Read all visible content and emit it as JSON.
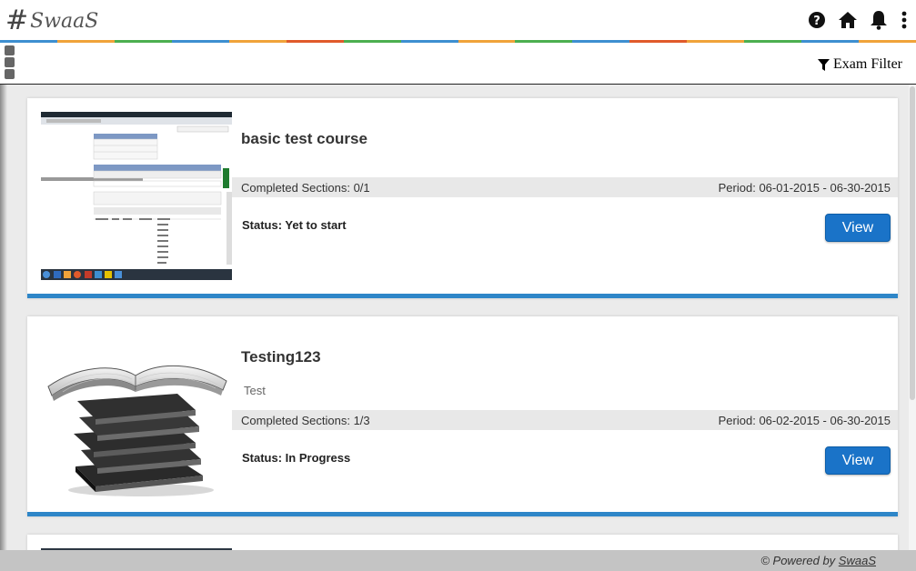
{
  "header": {
    "logo_hash": "#",
    "logo_text": "SwaaS",
    "icons": [
      "help-icon",
      "home-icon",
      "bell-icon",
      "kebab-menu-icon"
    ]
  },
  "stripe_colors": [
    "#3d8fd0",
    "#f0a33a",
    "#4caf50",
    "#3d8fd0",
    "#f0a33a",
    "#e05a2b",
    "#4caf50",
    "#3d8fd0",
    "#f0a33a",
    "#4caf50",
    "#3d8fd0",
    "#e05a2b",
    "#f0a33a",
    "#4caf50",
    "#3d8fd0",
    "#f0a33a"
  ],
  "toolbar": {
    "filter_label": "Exam Filter",
    "filter_icon": "funnel-icon"
  },
  "courses": [
    {
      "title": "basic test course",
      "description": "",
      "completed": "Completed Sections: 0/1",
      "period": "Period: 06-01-2015 - 06-30-2015",
      "status": "Status: Yet to start",
      "view_label": "View",
      "image": "screenshot-thumbnail"
    },
    {
      "title": "Testing123",
      "description": "Test",
      "completed": "Completed Sections: 1/3",
      "period": "Period: 06-02-2015 - 06-30-2015",
      "status": "Status: In Progress",
      "view_label": "View",
      "image": "book-stack"
    }
  ],
  "footer": {
    "prefix": "© Powered by ",
    "brand": "SwaaS"
  },
  "colors": {
    "accent": "#2e86c8",
    "button": "#1a73c8",
    "row_bg": "#e8e8e8"
  }
}
